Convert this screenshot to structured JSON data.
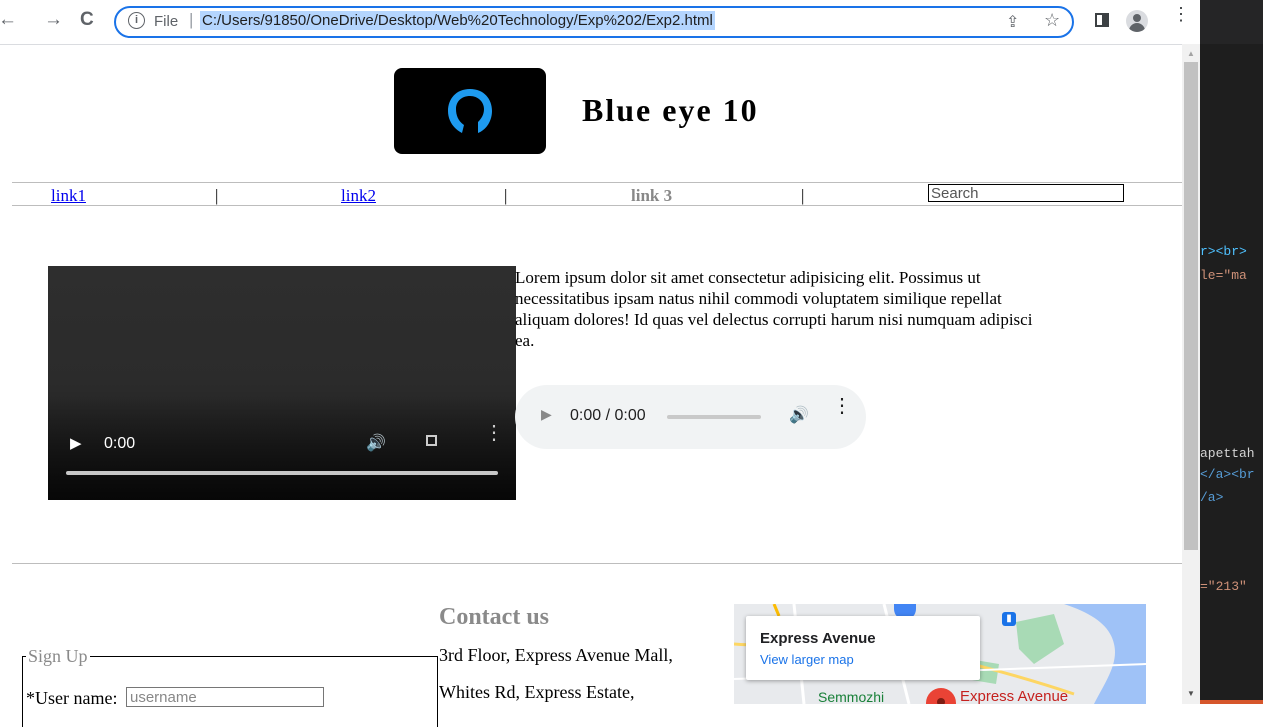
{
  "browser": {
    "back_glyph": "←",
    "forward_glyph": "→",
    "reload_glyph": "C",
    "info_glyph": "i",
    "file_label": "File",
    "separator": "|",
    "url": "C:/Users/91850/OneDrive/Desktop/Web%20Technology/Exp%202/Exp2.html",
    "share_glyph": "⇪",
    "star_glyph": "☆",
    "menu_glyph": "⋮",
    "accent_color": "#1a73e8"
  },
  "header": {
    "title": "Blue eye 10",
    "logo_icon": "head-silhouette-icon",
    "logo_color": "#1e9bf0"
  },
  "nav": {
    "links": [
      "link1",
      "link2",
      "link 3"
    ],
    "pipe": "|",
    "search_placeholder": "Search"
  },
  "media": {
    "description": "Lorem ipsum dolor sit amet consectetur adipisicing elit. Possimus ut necessitatibus ipsam natus nihil commodi voluptatem similique repellat aliquam dolores! Id quas vel delectus corrupti harum nisi numquam adipisci ea.",
    "video": {
      "time": "0:00",
      "play_glyph": "▶",
      "volume_glyph": "🔊",
      "menu_glyph": "⋮"
    },
    "audio": {
      "time": "0:00 / 0:00",
      "play_glyph": "▶",
      "volume_glyph": "🔊",
      "menu_glyph": "⋮"
    }
  },
  "signup": {
    "legend": "Sign Up",
    "username_label": "*User name:",
    "username_placeholder": "username"
  },
  "contact": {
    "title": "Contact us",
    "address_lines": [
      "3rd Floor, Express Avenue Mall,",
      "Whites Rd, Express Estate,"
    ]
  },
  "map": {
    "place_name": "Express Avenue",
    "view_link": "View larger map",
    "label_left": "Semmozhi",
    "label_right": "Express Avenue"
  },
  "devtools": {
    "lines": [
      {
        "text": "r><br>",
        "color": "#4fc1ff"
      },
      {
        "text": "le=\"ma",
        "color": "#ce9178"
      },
      {
        "text": "apettah",
        "color": "#d4d4d4"
      },
      {
        "text": "</a><br",
        "color": "#569cd6"
      },
      {
        "text": "/a>",
        "color": "#569cd6"
      },
      {
        "text": "=\"213\"",
        "color": "#ce9178"
      }
    ]
  }
}
